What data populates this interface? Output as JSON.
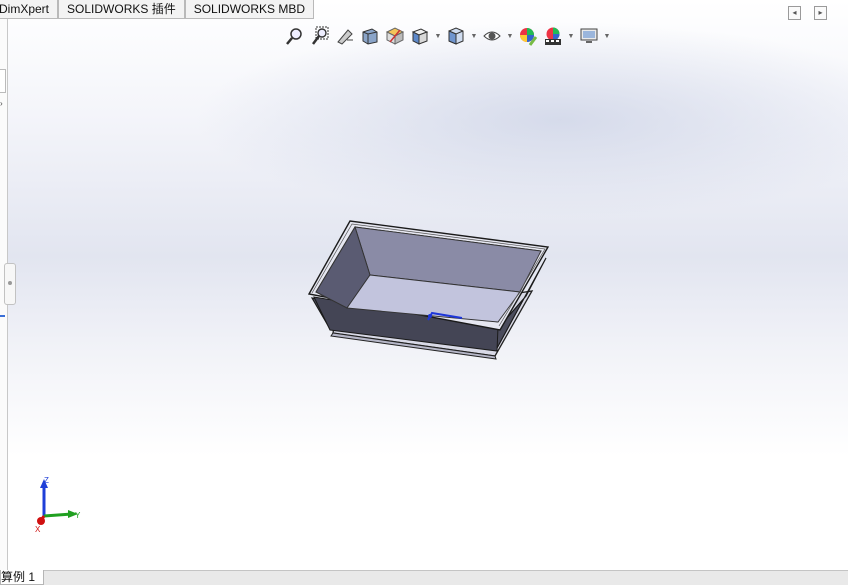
{
  "command_tabs": [
    {
      "label": "DimXpert"
    },
    {
      "label": "SOLIDWORKS 插件"
    },
    {
      "label": "SOLIDWORKS MBD"
    }
  ],
  "heads_up_toolbar": [
    {
      "icon": "zoom-to-fit-icon"
    },
    {
      "icon": "zoom-to-area-icon"
    },
    {
      "icon": "previous-view-icon"
    },
    {
      "icon": "section-view-icon"
    },
    {
      "icon": "dynamic-annotation-views-icon"
    },
    {
      "icon": "view-orientation-icon",
      "dropdown": true
    },
    {
      "icon": "display-style-icon",
      "dropdown": true
    },
    {
      "icon": "hide-show-items-icon",
      "dropdown": true
    },
    {
      "icon": "edit-appearance-icon"
    },
    {
      "icon": "apply-scene-icon",
      "dropdown": true
    },
    {
      "icon": "view-setting-icon",
      "dropdown": true
    }
  ],
  "triad": {
    "x_label": "X",
    "y_label": "Y",
    "z_label": "Z"
  },
  "bottom_tabs": [
    {
      "label": "算例 1"
    }
  ],
  "colors": {
    "part_dark": "#4e4f5e",
    "part_light": "#c9cbe0",
    "x_axis": "#d01010",
    "y_axis": "#20a020",
    "z_axis": "#1f3fd8"
  }
}
